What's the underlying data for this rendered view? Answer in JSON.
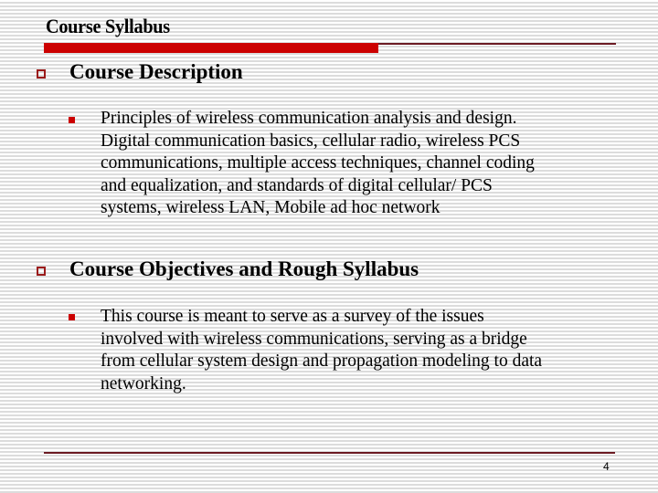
{
  "slide": {
    "title": "Course Syllabus",
    "page_number": "4",
    "colors": {
      "accent_bar": "#cc0000",
      "rule_line": "#6b1a22",
      "level1_bullet": "#9b1b1b",
      "level2_bullet": "#cc0000"
    }
  },
  "sections": [
    {
      "heading": "Course Description",
      "bullet_icon": "hollow-square",
      "items": [
        {
          "bullet_icon": "filled-square",
          "lines": [
            "Principles of wireless communication analysis and design.",
            "Digital communication basics, cellular radio, wireless PCS",
            "communications, multiple access techniques, channel coding",
            "and equalization, and standards of digital cellular/ PCS",
            "systems, wireless LAN, Mobile ad hoc network"
          ]
        }
      ]
    },
    {
      "heading": "Course Objectives and Rough Syllabus",
      "bullet_icon": "hollow-square",
      "items": [
        {
          "bullet_icon": "filled-square",
          "lines": [
            "This course is meant to serve as a survey of the issues",
            "involved with wireless communications, serving as a bridge",
            "from cellular system design and propagation modeling to data",
            "networking."
          ]
        }
      ]
    }
  ]
}
